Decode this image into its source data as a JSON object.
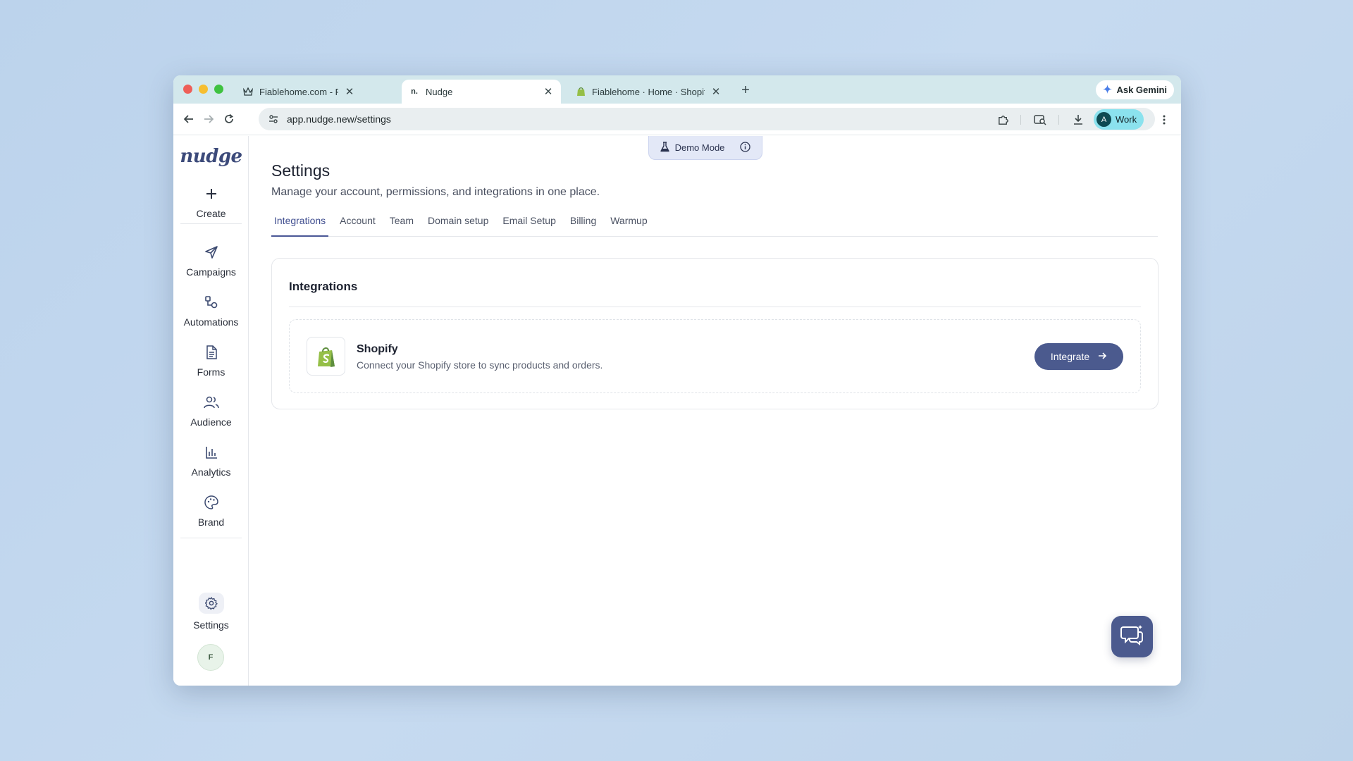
{
  "browser": {
    "tabs": [
      {
        "title": "Fiablehome.com - Premium K",
        "icon": "crown-icon",
        "active": false
      },
      {
        "title": "Nudge",
        "icon": "nudge-favicon",
        "active": true
      },
      {
        "title": "Fiablehome · Home · Shopify",
        "icon": "shopify-bag-icon",
        "active": false
      }
    ],
    "ask_gemini": "Ask Gemini",
    "url": "app.nudge.new/settings",
    "profile_initial": "A",
    "profile_label": "Work"
  },
  "sidebar": {
    "logo": "nudge",
    "items": [
      {
        "label": "Create",
        "icon": "plus-icon"
      },
      {
        "label": "Campaigns",
        "icon": "send-icon"
      },
      {
        "label": "Automations",
        "icon": "workflow-icon"
      },
      {
        "label": "Forms",
        "icon": "document-icon"
      },
      {
        "label": "Audience",
        "icon": "users-icon"
      },
      {
        "label": "Analytics",
        "icon": "bar-chart-icon"
      },
      {
        "label": "Brand",
        "icon": "palette-icon"
      }
    ],
    "settings_label": "Settings",
    "user_initial": "F"
  },
  "demo_mode": {
    "label": "Demo Mode"
  },
  "page": {
    "title": "Settings",
    "subtitle": "Manage your account, permissions, and integrations in one place.",
    "tabs": [
      "Integrations",
      "Account",
      "Team",
      "Domain setup",
      "Email Setup",
      "Billing",
      "Warmup"
    ],
    "active_tab": "Integrations"
  },
  "integrations": {
    "section_title": "Integrations",
    "items": [
      {
        "name": "Shopify",
        "description": "Connect your Shopify store to sync products and orders.",
        "button": "Integrate"
      }
    ]
  },
  "colors": {
    "accent": "#4b5a8e",
    "tab_strip": "#d3e8ec",
    "profile_chip": "#8be2ee"
  }
}
